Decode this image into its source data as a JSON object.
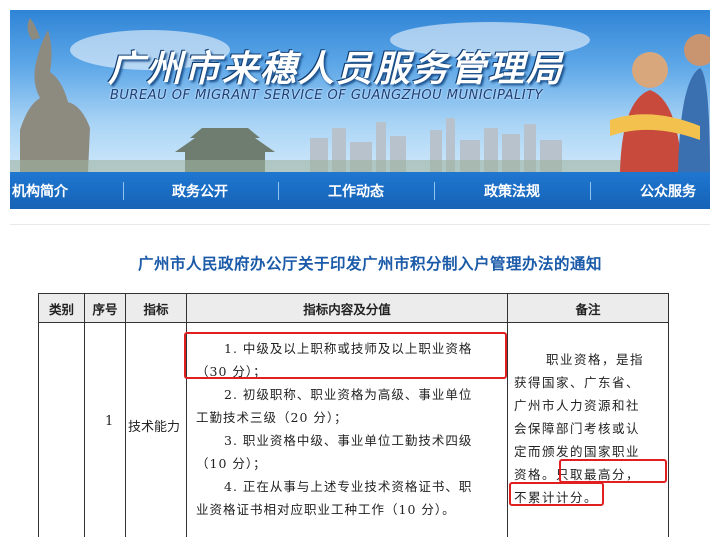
{
  "header": {
    "title": "广州市来穗人员服务管理局",
    "subtitle": "BUREAU OF MIGRANT SERVICE OF GUANGZHOU MUNICIPALITY"
  },
  "nav": {
    "items": [
      {
        "label": "机构简介"
      },
      {
        "label": "政务公开"
      },
      {
        "label": "工作动态"
      },
      {
        "label": "政策法规"
      },
      {
        "label": "公众服务"
      }
    ]
  },
  "notice": {
    "title": "广州市人民政府办公厅关于印发广州市积分制入户管理办法的通知"
  },
  "table": {
    "headers": [
      "类别",
      "序号",
      "指标",
      "指标内容及分值",
      "备注"
    ],
    "row": {
      "number": "1",
      "indicator": "技术能力",
      "content_lines": [
        "1. 中级及以上职称或技师及以上职业资格",
        "（30 分）；",
        "2. 初级职称、职业资格为高级、事业单位",
        "工勤技术三级（20 分）；",
        "3. 职业资格中级、事业单位工勤技术四级",
        "（10 分）；",
        "4. 正在从事与上述专业技术资格证书、职",
        "业资格证书相对应职业工种工作（10 分）。"
      ],
      "note_lines": [
        "职业资格，是指",
        "获得国家、广东省、",
        "广州市人力资源和社",
        "会保障部门考核或认",
        "定而颁发的国家职业",
        "资格。只取最高分，",
        "不累计计分。"
      ]
    }
  },
  "highlight_color": "#e02020"
}
